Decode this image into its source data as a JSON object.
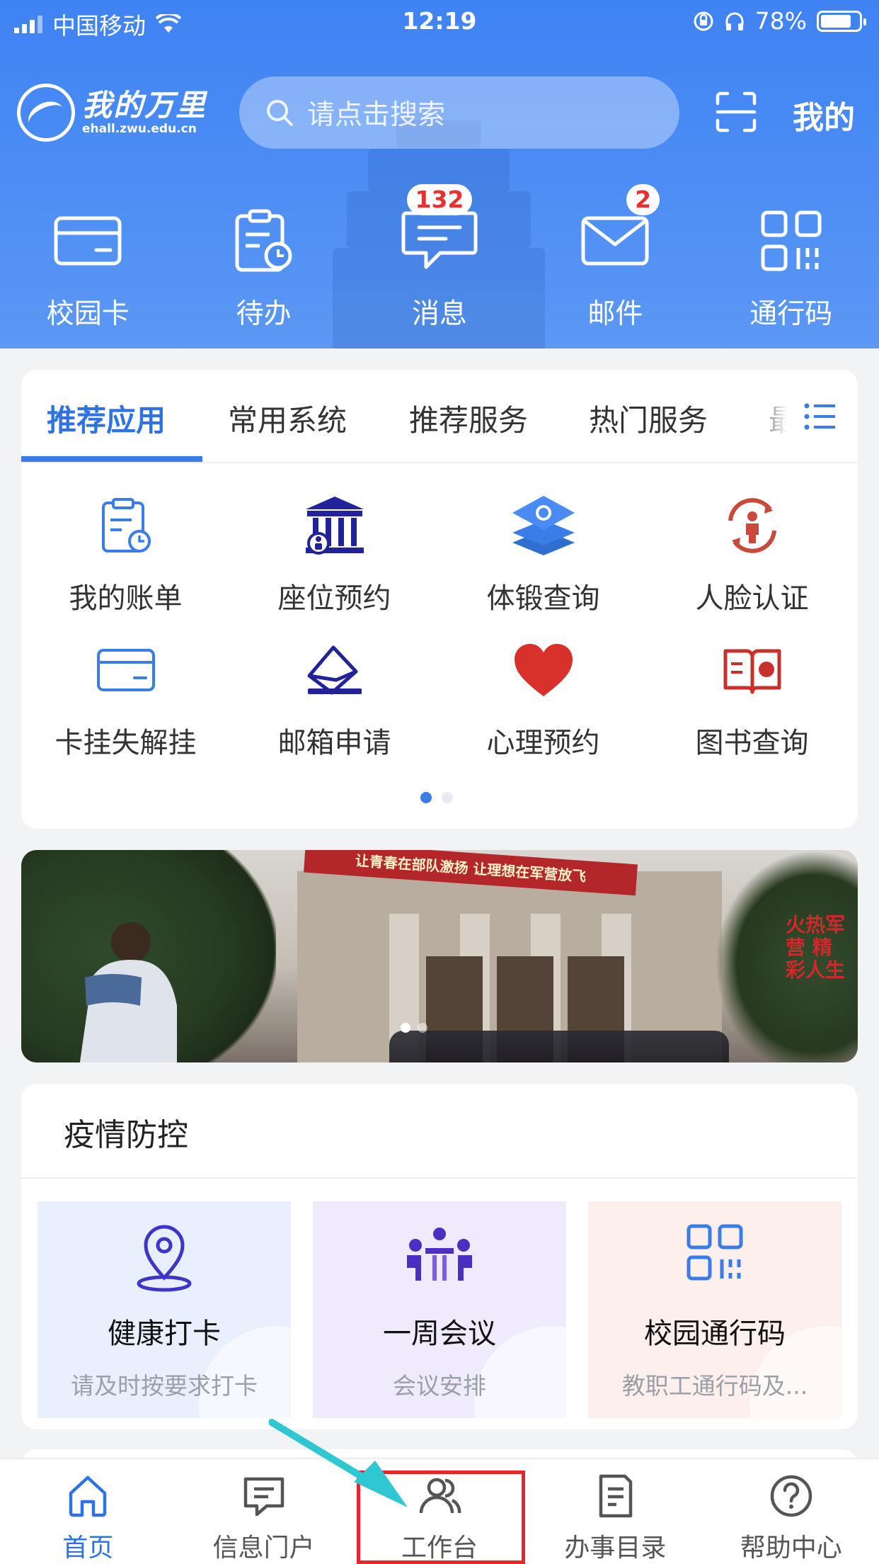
{
  "status_bar": {
    "carrier": "中国移动",
    "time": "12:19",
    "battery": "78%"
  },
  "header": {
    "logo_text": "我的万里",
    "logo_domain": "ehall.zwu.edu.cn",
    "search_placeholder": "请点击搜索",
    "mine_label": "我的"
  },
  "quick_actions": [
    {
      "label": "校园卡",
      "icon": "card-icon",
      "badge": null
    },
    {
      "label": "待办",
      "icon": "todo-clipboard-icon",
      "badge": null
    },
    {
      "label": "消息",
      "icon": "message-icon",
      "badge": "132"
    },
    {
      "label": "邮件",
      "icon": "mail-icon",
      "badge": "2"
    },
    {
      "label": "通行码",
      "icon": "qr-grid-icon",
      "badge": null
    }
  ],
  "app_tabs": [
    "推荐应用",
    "常用系统",
    "推荐服务",
    "热门服务",
    "最"
  ],
  "apps": [
    {
      "label": "我的账单",
      "icon": "bill-icon"
    },
    {
      "label": "座位预约",
      "icon": "library-seat-icon"
    },
    {
      "label": "体锻查询",
      "icon": "layers-icon"
    },
    {
      "label": "人脸认证",
      "icon": "face-auth-icon"
    },
    {
      "label": "卡挂失解挂",
      "icon": "card-icon"
    },
    {
      "label": "邮箱申请",
      "icon": "envelope-icon"
    },
    {
      "label": "心理预约",
      "icon": "heart-icon"
    },
    {
      "label": "图书查询",
      "icon": "book-icon"
    }
  ],
  "banner": {
    "slogan_top": "让青春在部队激扬 让理想在军营放飞",
    "slogan_side": "火热军营 精彩人生"
  },
  "epidemic": {
    "title": "疫情防控",
    "tiles": [
      {
        "title": "健康打卡",
        "subtitle": "请及时按要求打卡",
        "icon": "location-pin-icon",
        "bg": "#e8f0fd"
      },
      {
        "title": "一周会议",
        "subtitle": "会议安排",
        "icon": "meeting-icon",
        "bg": "#efeafc"
      },
      {
        "title": "校园通行码",
        "subtitle": "教职工通行码及...",
        "icon": "qr-grid-icon",
        "bg": "#fcefec"
      }
    ]
  },
  "bottom_nav": [
    {
      "label": "首页",
      "icon": "home-icon",
      "active": true
    },
    {
      "label": "信息门户",
      "icon": "chat-icon",
      "active": false
    },
    {
      "label": "工作台",
      "icon": "users-icon",
      "active": false
    },
    {
      "label": "办事目录",
      "icon": "document-icon",
      "active": false
    },
    {
      "label": "帮助中心",
      "icon": "help-icon",
      "active": false
    }
  ],
  "colors": {
    "primary": "#3a7de9",
    "badge": "#e8312f",
    "highlight": "#e6262b",
    "arrow": "#2fc8d2"
  }
}
